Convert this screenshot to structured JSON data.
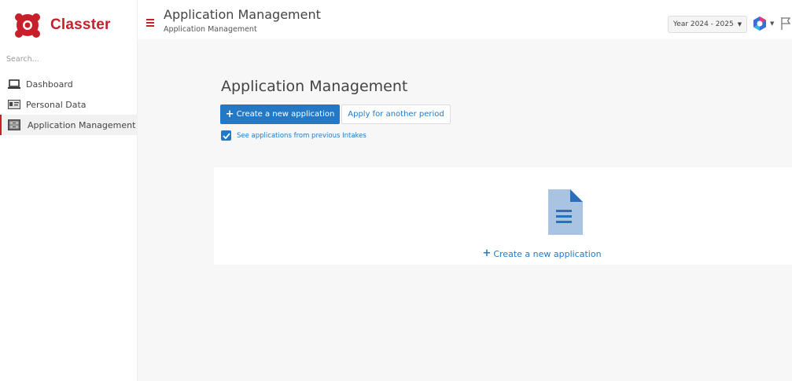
{
  "app": {
    "name": "Classter"
  },
  "sidebar": {
    "search_placeholder": "Search...",
    "items": [
      {
        "label": "Dashboard",
        "icon": "laptop-icon"
      },
      {
        "label": "Personal Data",
        "icon": "id-card-icon"
      },
      {
        "label": "Application Management",
        "icon": "drawer-icon",
        "active": true
      }
    ]
  },
  "header": {
    "title": "Application Management",
    "breadcrumb": "Application Management",
    "year_selector": "Year 2024 - 2025",
    "icons": [
      "hamburger-icon",
      "apps-logo-icon",
      "flag-icon"
    ]
  },
  "main": {
    "title": "Application Management",
    "create_button": "Create a new application",
    "apply_button": "Apply for another period",
    "checkbox": {
      "label": "See applications from previous Intakes",
      "checked": true
    },
    "empty_state": {
      "icon": "document-icon",
      "link": "Create a new application"
    }
  },
  "colors": {
    "brand": "#c8202a",
    "accent": "#2479c6",
    "doc_icon": "#a9c4e3"
  }
}
